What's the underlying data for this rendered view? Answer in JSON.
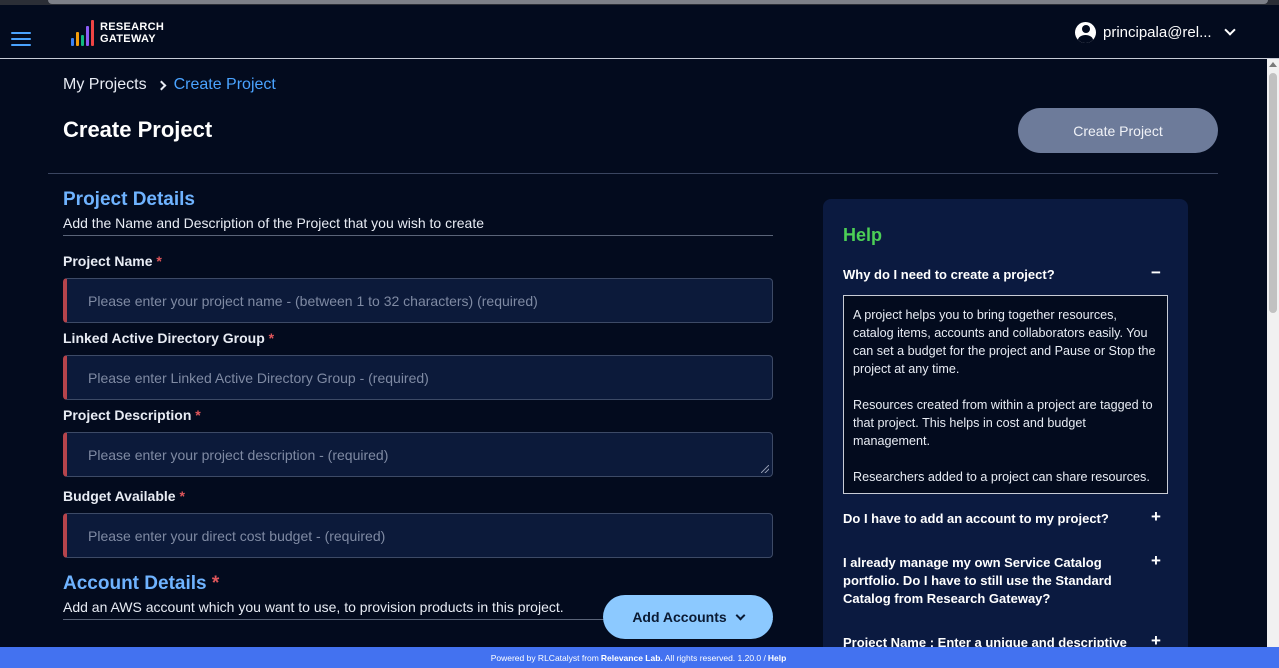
{
  "header": {
    "logo_line1": "RESEARCH",
    "logo_line2": "GATEWAY",
    "user_name": "principala@rel..."
  },
  "breadcrumb": {
    "parent": "My Projects",
    "current": "Create Project"
  },
  "page": {
    "title": "Create Project",
    "create_button": "Create Project"
  },
  "project_details": {
    "title": "Project Details",
    "subtitle": "Add the Name and Description of the Project that you wish to create",
    "fields": [
      {
        "label": "Project Name",
        "placeholder": "Please enter your project name - (between 1 to 32 characters) (required)"
      },
      {
        "label": "Linked Active Directory Group",
        "placeholder": "Please enter Linked Active Directory Group - (required)"
      },
      {
        "label": "Project Description",
        "placeholder": "Please enter your project description - (required)"
      },
      {
        "label": "Budget Available",
        "placeholder": "Please enter your direct cost budget - (required)"
      }
    ],
    "required_mark": "*"
  },
  "account_details": {
    "title": "Account Details",
    "subtitle": "Add an AWS account which you want to use, to provision products in this project.",
    "add_button": "Add Accounts"
  },
  "help": {
    "title": "Help",
    "faqs": [
      {
        "question": "Why do I need to create a project?",
        "toggle": "−",
        "answer": [
          "A project helps you to bring together resources, catalog items, accounts and collaborators easily. You can set a budget for the project and Pause or Stop the project at any time.",
          "Resources created from within a project are tagged to that project. This helps in cost and budget management.",
          "Researchers added to a project can share resources."
        ]
      },
      {
        "question": "Do I have to add an account to my project?",
        "toggle": "+"
      },
      {
        "question": "I already manage my own Service Catalog portfolio. Do I have to still use the Standard Catalog from Research Gateway?",
        "toggle": "+"
      },
      {
        "question": "Project Name : Enter a unique and descriptive",
        "toggle": "+"
      }
    ]
  },
  "footer": {
    "prefix": "Powered by RLCatalyst from",
    "company": "Relevance Lab.",
    "rights": "All rights reserved. 1.20.0 /",
    "help_link": "Help"
  },
  "colors": {
    "background": "#030b1e",
    "accent_blue": "#4aa3ff",
    "help_green": "#4ccf56",
    "required_red": "#e0565b",
    "footer_blue": "#4372f0"
  }
}
